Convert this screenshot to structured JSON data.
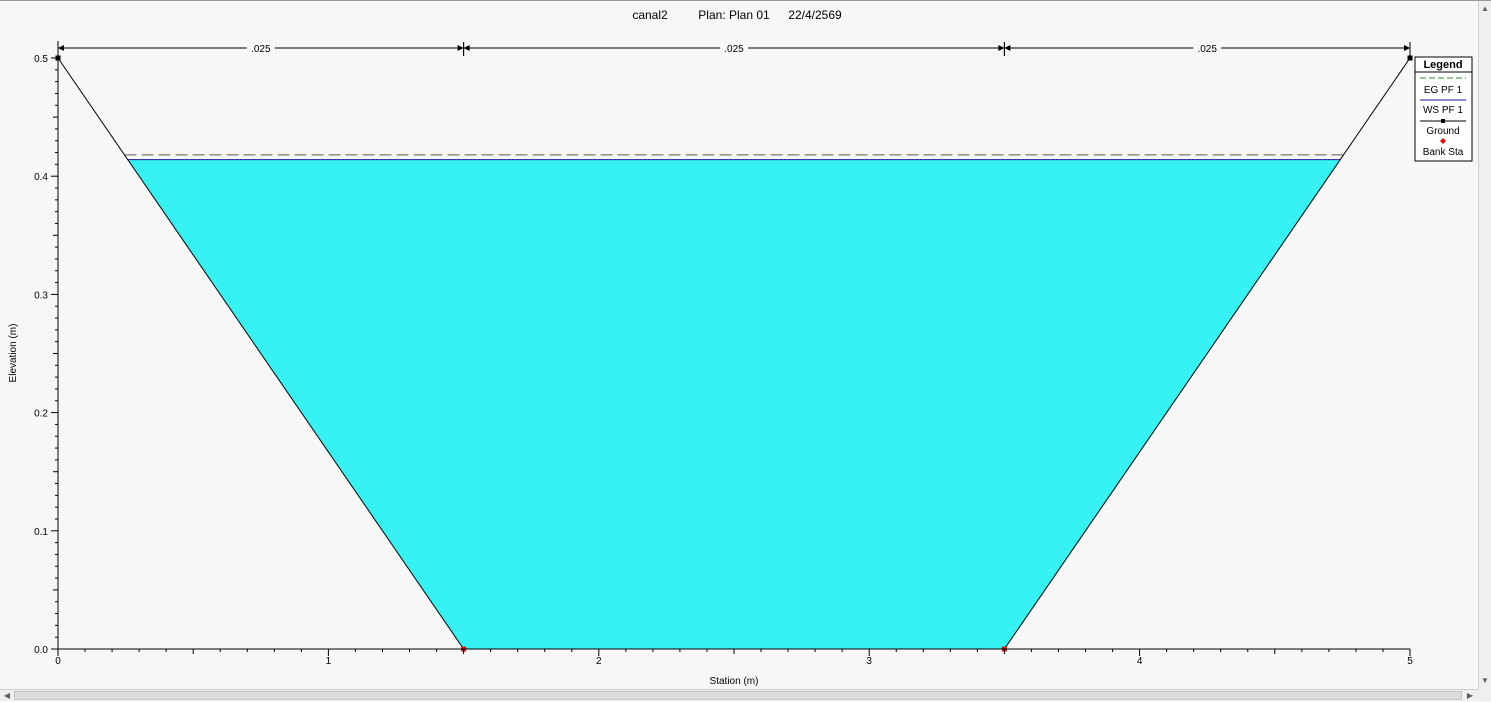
{
  "chart_data": {
    "type": "area",
    "title_parts": [
      "canal2",
      "Plan: Plan 01",
      "22/4/2569"
    ],
    "xlabel": "Station (m)",
    "ylabel": "Elevation (m)",
    "xlim": [
      0,
      5
    ],
    "ylim": [
      0,
      0.5
    ],
    "x_ticks": [
      0,
      1,
      2,
      3,
      4,
      5
    ],
    "x_tick_labels": [
      "0",
      "1",
      "2",
      "3",
      "4",
      "5"
    ],
    "y_ticks": [
      0.0,
      0.1,
      0.2,
      0.3,
      0.4,
      0.5
    ],
    "y_tick_labels": [
      "0.0",
      "0.1",
      "0.2",
      "0.3",
      "0.4",
      "0.5"
    ],
    "ground": {
      "x": [
        0,
        1.5,
        3.5,
        5
      ],
      "y": [
        0.5,
        0,
        0,
        0.5
      ]
    },
    "bank_stations": {
      "x": [
        1.5,
        3.5
      ],
      "y": [
        0,
        0
      ]
    },
    "ws_elevation": 0.414,
    "eg_elevation": 0.418,
    "mannings_n": [
      {
        "label": ".025",
        "from": 0,
        "to": 1.5
      },
      {
        "label": ".025",
        "from": 1.5,
        "to": 3.5
      },
      {
        "label": ".025",
        "from": 3.5,
        "to": 5
      }
    ],
    "legend": {
      "title": "Legend",
      "entries": [
        {
          "name": "EG PF 1",
          "color": "#2e8b2e",
          "style": "dashed-line"
        },
        {
          "name": "WS PF 1",
          "color": "#1a1aa0",
          "style": "line"
        },
        {
          "name": "Ground",
          "color": "#000000",
          "style": "line-square-marker"
        },
        {
          "name": "Bank Sta",
          "color": "#e01010",
          "style": "diamond-marker"
        }
      ]
    },
    "colors": {
      "water": "#36f2f2",
      "ground": "#000000",
      "eg": "#5a5a5a",
      "ws": "#1a1aa0",
      "bank": "#e01010"
    }
  }
}
